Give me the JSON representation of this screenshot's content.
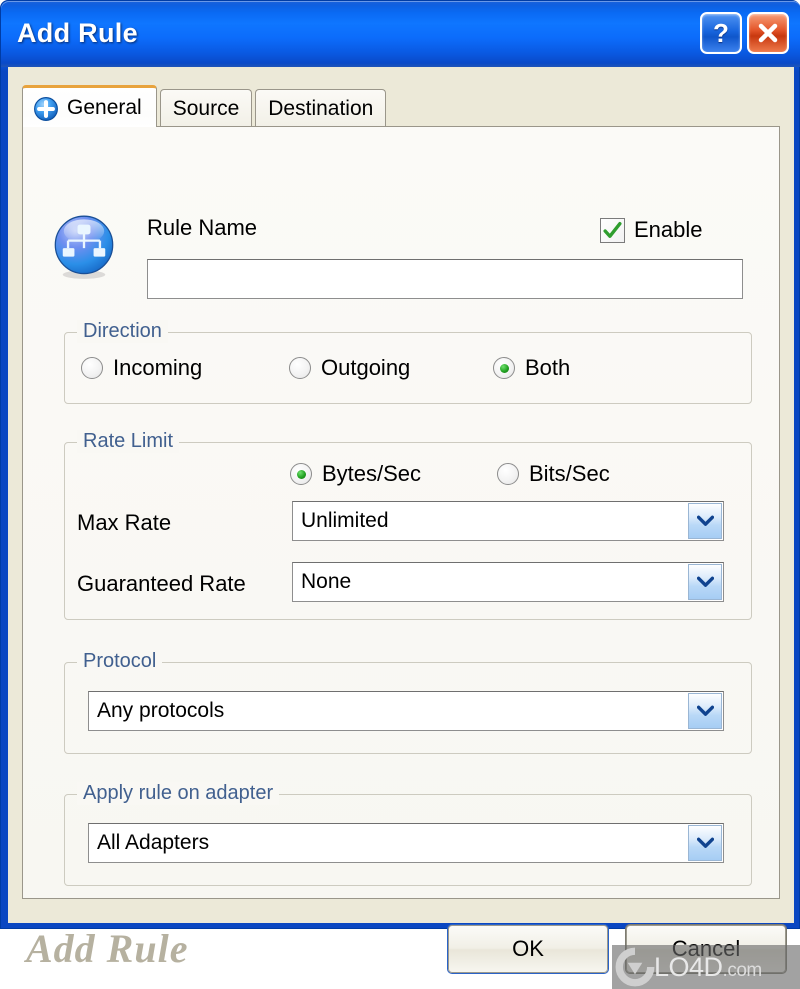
{
  "window": {
    "title": "Add Rule",
    "help_button": "?",
    "close_button": "close-icon"
  },
  "tabs": [
    {
      "label": "General",
      "active": true,
      "icon": "add-circle-icon"
    },
    {
      "label": "Source",
      "active": false
    },
    {
      "label": "Destination",
      "active": false
    }
  ],
  "general": {
    "rule_name_label": "Rule Name",
    "rule_name_value": "",
    "rule_name_placeholder": "",
    "enable_label": "Enable",
    "enable_checked": true,
    "rule_icon": "network-rule-icon"
  },
  "direction": {
    "legend": "Direction",
    "options": [
      {
        "label": "Incoming",
        "selected": false
      },
      {
        "label": "Outgoing",
        "selected": false
      },
      {
        "label": "Both",
        "selected": true
      }
    ]
  },
  "rate_limit": {
    "legend": "Rate Limit",
    "unit_options": [
      {
        "label": "Bytes/Sec",
        "selected": true
      },
      {
        "label": "Bits/Sec",
        "selected": false
      }
    ],
    "max_rate_label": "Max Rate",
    "max_rate_value": "Unlimited",
    "guaranteed_rate_label": "Guaranteed Rate",
    "guaranteed_rate_value": "None"
  },
  "protocol": {
    "legend": "Protocol",
    "value": "Any protocols"
  },
  "adapter": {
    "legend": "Apply rule on adapter",
    "value": "All Adapters"
  },
  "footer": {
    "watermark": "Add Rule",
    "ok_label": "OK",
    "cancel_label": "Cancel"
  },
  "overlay": {
    "site_name": "LO4D",
    "site_tld": ".com"
  },
  "colors": {
    "titlebar_blue": "#0c6cfb",
    "frame_blue": "#0a47c2",
    "dialog_face": "#ECE9D8",
    "active_tab_accent": "#E8A33D",
    "legend_text": "#41608f",
    "radio_green": "#23a323",
    "check_green": "#2f9e2f"
  }
}
